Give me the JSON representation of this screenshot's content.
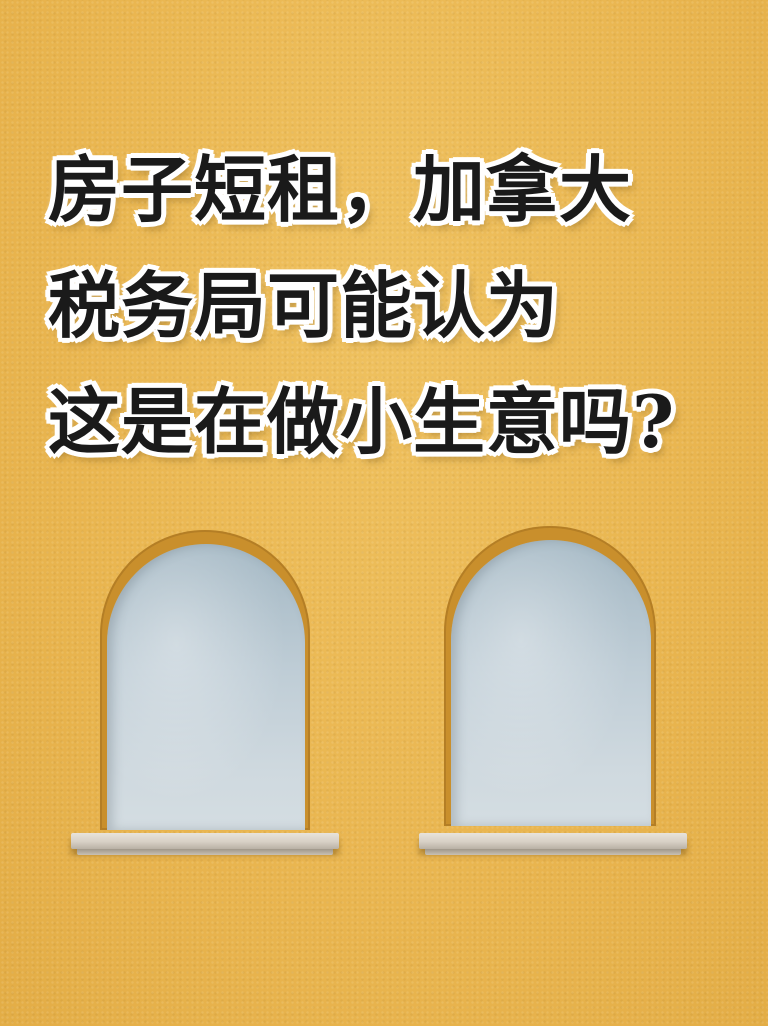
{
  "headline": {
    "line1": "房子短租，加拿大",
    "line2": "税务局可能认为",
    "line3": "这是在做小生意吗?"
  },
  "colors": {
    "wall": "#ebb753",
    "text": "#1a1a1a",
    "text_outline": "#ffffff",
    "glass": "#c4d2da",
    "sill": "#ddd6cc"
  }
}
